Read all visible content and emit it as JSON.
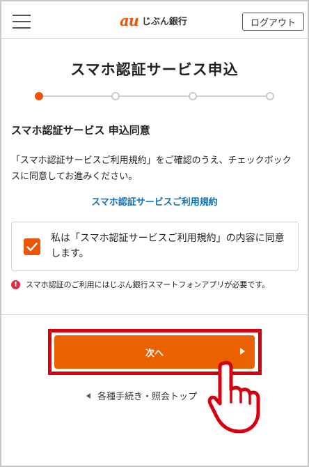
{
  "header": {
    "logo_mark": "au",
    "logo_bank": "じぶん銀行",
    "logout_label": "ログアウト"
  },
  "page": {
    "title": "スマホ認証サービス申込",
    "stepper": {
      "total_steps": 4,
      "current_step": 1
    }
  },
  "consent": {
    "section_title": "スマホ認証サービス 申込同意",
    "description": "「スマホ認証サービスご利用規約」をご確認のうえ、チェックボックスに同意してお進みください。",
    "terms_link": "スマホ認証サービスご利用規約",
    "checkbox_checked": true,
    "checkbox_label": "私は「スマホ認証サービスご利用規約」の内容に同意します。",
    "notice_icon": "!",
    "notice": "スマホ認証のご利用にはじぶん銀行スマートフォンアプリが必要です。"
  },
  "actions": {
    "next_label": "次へ",
    "back_label": "各種手続き・照会トップ"
  },
  "colors": {
    "accent": "#eb6100",
    "link": "#0e73b8",
    "highlight": "#d6000f",
    "notice": "#d9304a"
  },
  "icons": [
    "menu-icon",
    "check-icon",
    "alert-icon",
    "arrow-right-icon",
    "arrow-left-icon",
    "pointing-hand-icon"
  ]
}
